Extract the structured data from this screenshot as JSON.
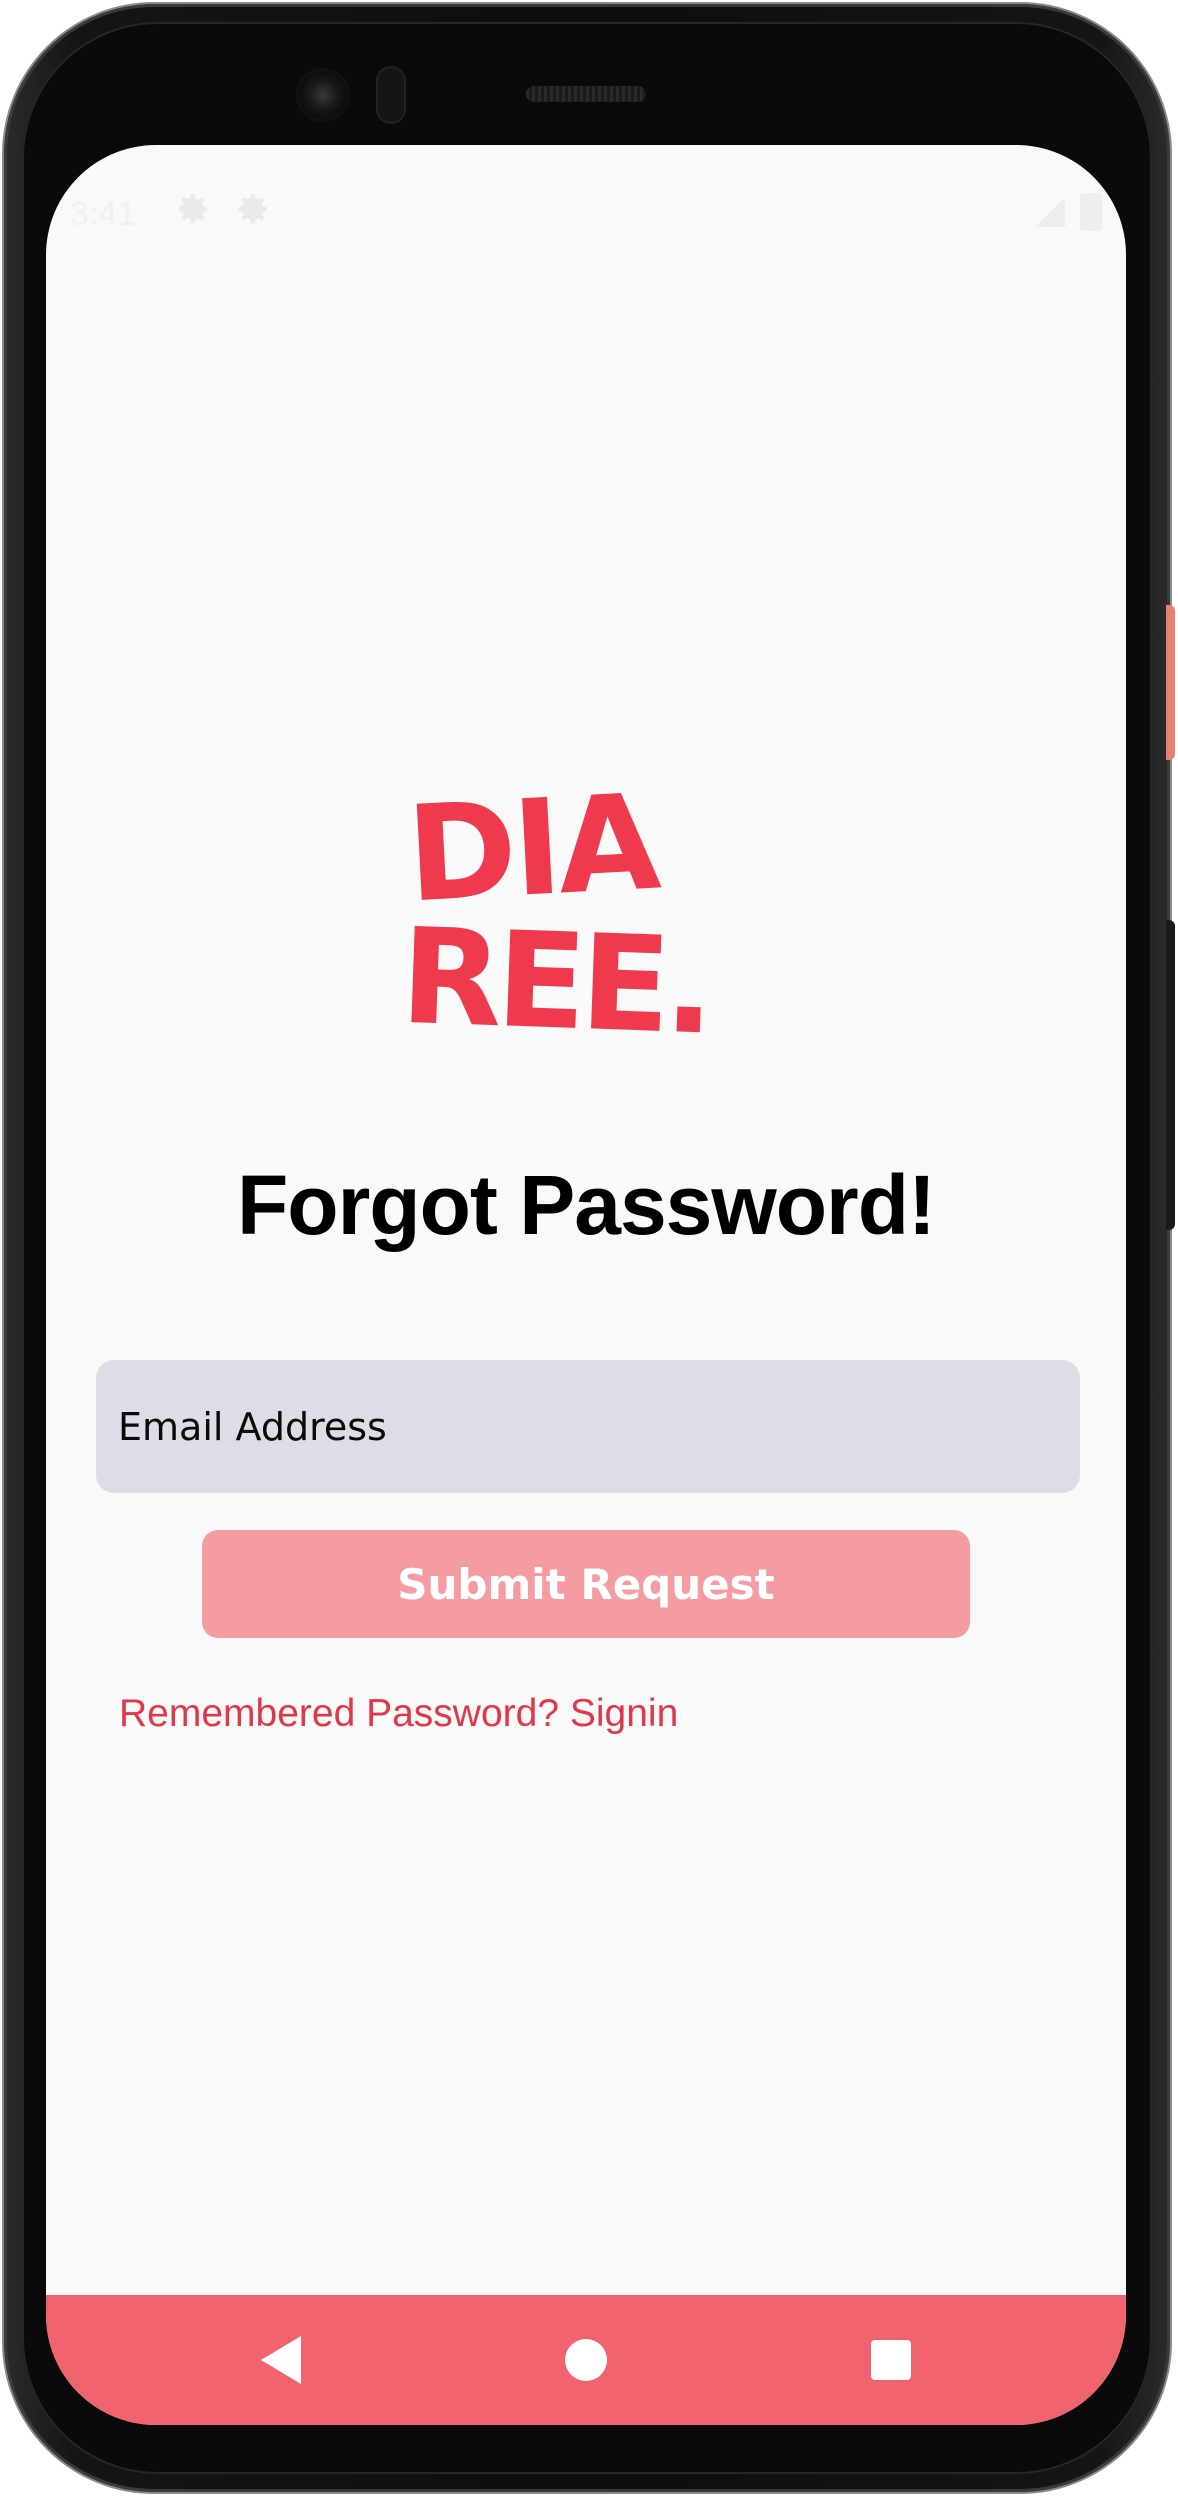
{
  "status_bar": {
    "time": "3:41"
  },
  "brand": {
    "logo_text_line1": "DIA",
    "logo_text_line2": "REE.",
    "color": "#ee3a4c"
  },
  "screen": {
    "title": "Forgot Password!",
    "email_placeholder": "Email Address",
    "submit_label": "Submit Request",
    "signin_link": "Remembered Password? Signin"
  },
  "colors": {
    "accent": "#ee3a4c",
    "button_disabled": "#f59ca3",
    "nav_bar": "#f0636f",
    "field_bg": "#deddE7"
  },
  "nav": {
    "back_icon": "back-triangle-icon",
    "home_icon": "home-circle-icon",
    "recents_icon": "recents-square-icon"
  }
}
